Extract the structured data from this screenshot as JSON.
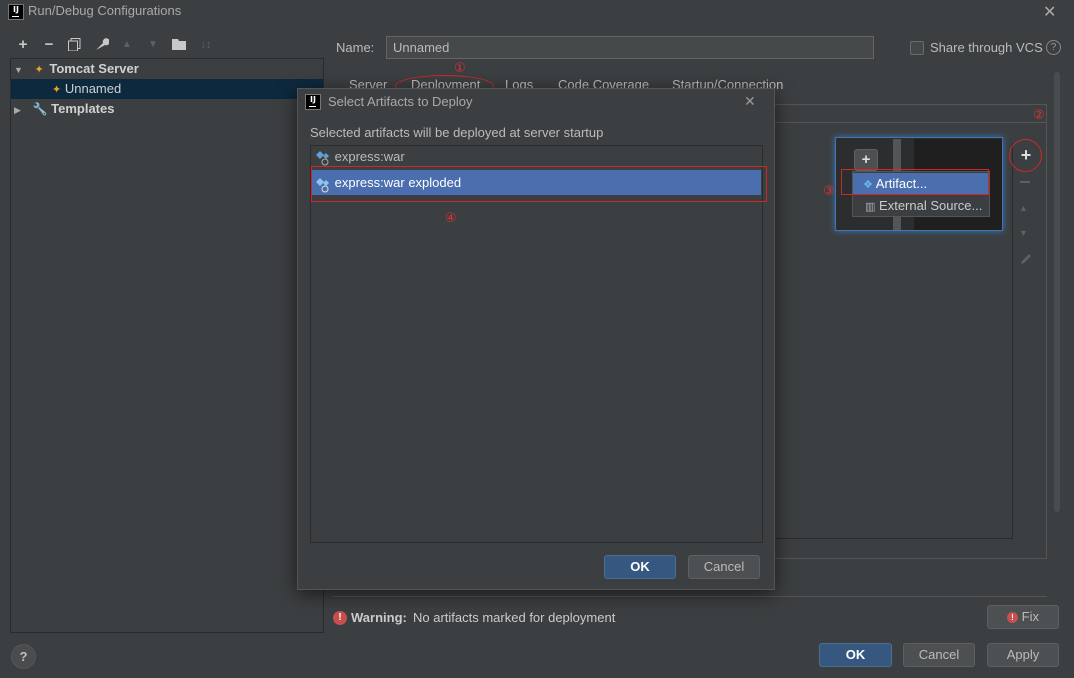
{
  "window": {
    "title": "Run/Debug Configurations"
  },
  "toolbar": {
    "add": "+",
    "remove": "−"
  },
  "tree": {
    "items": [
      {
        "label": "Tomcat Server"
      },
      {
        "label": "Unnamed"
      },
      {
        "label": "Templates"
      }
    ]
  },
  "config": {
    "name_label": "Name:",
    "name_value": "Unnamed",
    "share_label": "Share through VCS",
    "tabs": [
      "Server",
      "Deployment",
      "Logs",
      "Code Coverage",
      "Startup/Connection"
    ]
  },
  "annotations": {
    "one": "①",
    "two": "②",
    "three": "③",
    "four": "④"
  },
  "popup": {
    "plus": "+",
    "items": [
      {
        "label": "Artifact..."
      },
      {
        "label": "External Source..."
      }
    ]
  },
  "side_buttons": {
    "add": "+"
  },
  "dialog": {
    "title": "Select Artifacts to Deploy",
    "description": "Selected artifacts will be deployed at server startup",
    "artifacts": [
      {
        "label": "express:war"
      },
      {
        "label": "express:war exploded"
      }
    ],
    "ok": "OK",
    "cancel": "Cancel"
  },
  "warning": {
    "label": "Warning:",
    "text": "No artifacts marked for deployment",
    "fix": "Fix"
  },
  "footer": {
    "ok": "OK",
    "cancel": "Cancel",
    "apply": "Apply",
    "help": "?"
  },
  "colors": {
    "accent": "#365880",
    "selection": "#4b6eaf",
    "annotation": "#d02828",
    "warning": "#c94f4f"
  }
}
